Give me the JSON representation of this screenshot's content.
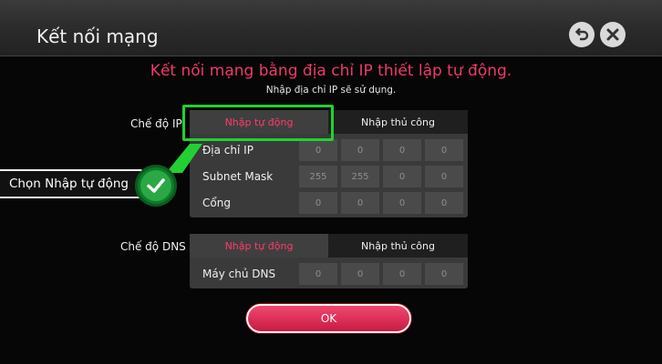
{
  "header": {
    "title": "Kết nối mạng",
    "back_icon": "back-arrow-icon",
    "close_icon": "close-icon"
  },
  "message": {
    "headline": "Kết nối mạng bằng địa chỉ IP thiết lập tự động.",
    "subline": "Nhập địa chỉ IP sẽ sử dụng."
  },
  "ip_mode": {
    "label": "Chế độ IP",
    "options": [
      "Nhập tự động",
      "Nhập thủ công"
    ],
    "selected": "Nhập tự động",
    "fields": [
      {
        "label": "Địa chỉ IP",
        "octets": [
          "0",
          "0",
          "0",
          "0"
        ]
      },
      {
        "label": "Subnet Mask",
        "octets": [
          "255",
          "255",
          "0",
          "0"
        ]
      },
      {
        "label": "Cổng",
        "octets": [
          "0",
          "0",
          "0",
          "0"
        ]
      }
    ]
  },
  "dns_mode": {
    "label": "Chế độ DNS",
    "options": [
      "Nhập tự động",
      "Nhập thủ công"
    ],
    "selected": "Nhập tự động",
    "fields": [
      {
        "label": "Máy chủ DNS",
        "octets": [
          "0",
          "0",
          "0",
          "0"
        ]
      }
    ]
  },
  "annotation": {
    "callout": "Chọn Nhập tự động",
    "highlight_color": "#22d033"
  },
  "ok_label": "OK",
  "colors": {
    "accent": "#ef3a6a",
    "background": "#060606"
  }
}
